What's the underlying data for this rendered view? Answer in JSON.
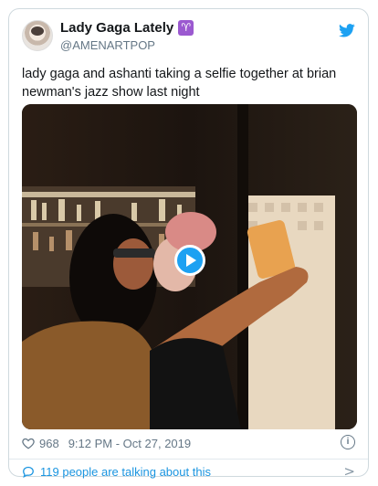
{
  "account": {
    "display_name": "Lady Gaga Lately",
    "handle": "@AMENARTPOP",
    "badge_glyph": "♈"
  },
  "tweet": {
    "text": "lady gaga and ashanti taking a selfie together at brian newman's jazz show last night"
  },
  "media": {
    "type": "video",
    "icon": "play-icon"
  },
  "meta": {
    "likes": "968",
    "timestamp": "9:12 PM - Oct 27, 2019"
  },
  "footer": {
    "talking_label": "119 people are talking about this"
  },
  "colors": {
    "accent": "#1da1f2",
    "link": "#1b95e0",
    "muted": "#657786",
    "badge": "#9b59d0"
  }
}
